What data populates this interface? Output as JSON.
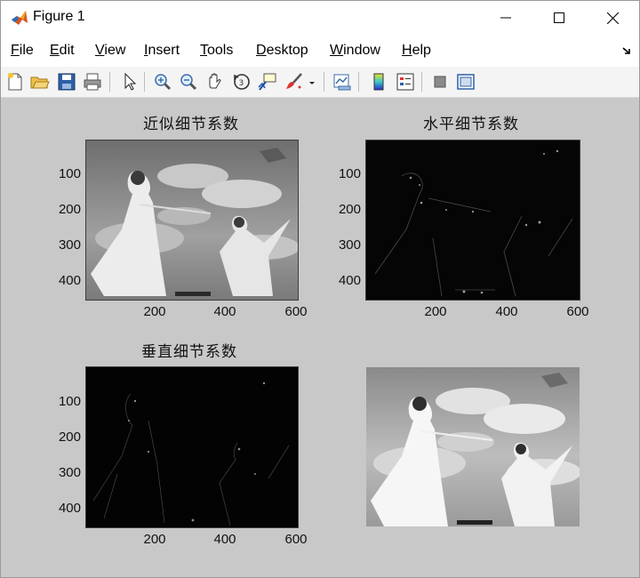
{
  "window": {
    "title": "Figure 1",
    "controls": {
      "minimize": "minimize-icon",
      "maximize": "maximize-icon",
      "close": "close-icon"
    }
  },
  "menu": [
    {
      "label": "File"
    },
    {
      "label": "Edit"
    },
    {
      "label": "View"
    },
    {
      "label": "Insert"
    },
    {
      "label": "Tools"
    },
    {
      "label": "Desktop"
    },
    {
      "label": "Window"
    },
    {
      "label": "Help"
    }
  ],
  "toolbar": [
    "new-figure-icon",
    "open-file-icon",
    "save-icon",
    "print-icon",
    "select-arrow-icon",
    "zoom-in-icon",
    "zoom-out-icon",
    "pan-hand-icon",
    "rotate-3d-icon",
    "data-cursor-icon",
    "brush-icon",
    "brush-dropdown-icon",
    "link-plot-icon",
    "colorbar-icon",
    "legend-icon",
    "hide-plot-tools-icon",
    "show-plot-tools-icon"
  ],
  "subplots": [
    {
      "title": "近似细节系数",
      "yticks": [
        "100",
        "200",
        "300",
        "400"
      ],
      "xticks": [
        "200",
        "400",
        "600"
      ],
      "image": "approximation"
    },
    {
      "title": "水平细节系数",
      "yticks": [
        "100",
        "200",
        "300",
        "400"
      ],
      "xticks": [
        "200",
        "400",
        "600"
      ],
      "image": "horizontal-detail"
    },
    {
      "title": "垂直细节系数",
      "yticks": [
        "100",
        "200",
        "300",
        "400"
      ],
      "xticks": [
        "200",
        "400",
        "600"
      ],
      "image": "vertical-detail"
    },
    {
      "title": "",
      "yticks": [],
      "xticks": [],
      "image": "reconstructed"
    }
  ],
  "colors": {
    "figure_bg": "#c8c8c8",
    "toolbar_bg": "#f4f4f4"
  }
}
